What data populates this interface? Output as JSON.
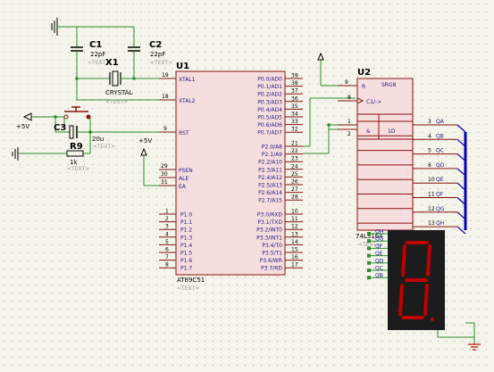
{
  "colors": {
    "background": "#f4f4ea",
    "grid_dot": "#a8a8a8",
    "wire": "#2e8b2e",
    "ic_body": "#f7dede",
    "ic_outline": "#8b1010",
    "bus": "#0000b8",
    "segment_off": "#c00000",
    "display_body": "#1c1c1c",
    "pin_label": "#1a1a8a",
    "text_placeholder": "#9a9a9a"
  },
  "u1": {
    "name": "U1",
    "part": "AT89C51",
    "text": "<TEXT>",
    "xtal1": "XTAL1",
    "xtal2": "XTAL2",
    "rst": "RST",
    "psen": "PSEN",
    "ale": "ALE",
    "ea": "EA",
    "pin_xtal1": "19",
    "pin_xtal2": "18",
    "pin_rst": "9",
    "pin_psen": "29",
    "pin_ale": "30",
    "pin_ea": "31",
    "p0": [
      {
        "name": "P0.0/AD0",
        "pin": "39"
      },
      {
        "name": "P0.1/AD1",
        "pin": "38"
      },
      {
        "name": "P0.2/AD2",
        "pin": "37"
      },
      {
        "name": "P0.3/AD3",
        "pin": "36"
      },
      {
        "name": "P0.4/AD4",
        "pin": "35"
      },
      {
        "name": "P0.5/AD5",
        "pin": "34"
      },
      {
        "name": "P0.6/AD6",
        "pin": "33"
      },
      {
        "name": "P0.7/AD7",
        "pin": "32"
      }
    ],
    "p2": [
      {
        "name": "P2.0/A8",
        "pin": "21"
      },
      {
        "name": "P2.1/A9",
        "pin": "22"
      },
      {
        "name": "P2.2/A10",
        "pin": "23"
      },
      {
        "name": "P2.3/A11",
        "pin": "24"
      },
      {
        "name": "P2.4/A12",
        "pin": "25"
      },
      {
        "name": "P2.5/A13",
        "pin": "26"
      },
      {
        "name": "P2.6/A14",
        "pin": "27"
      },
      {
        "name": "P2.7/A15",
        "pin": "28"
      }
    ],
    "p1": [
      {
        "name": "P1.0",
        "pin": "1"
      },
      {
        "name": "P1.1",
        "pin": "2"
      },
      {
        "name": "P1.2",
        "pin": "3"
      },
      {
        "name": "P1.3",
        "pin": "4"
      },
      {
        "name": "P1.4",
        "pin": "5"
      },
      {
        "name": "P1.5",
        "pin": "6"
      },
      {
        "name": "P1.6",
        "pin": "7"
      },
      {
        "name": "P1.7",
        "pin": "8"
      }
    ],
    "p3": [
      {
        "name": "P3.0/RXD",
        "pin": "10"
      },
      {
        "name": "P3.1/TXD",
        "pin": "11"
      },
      {
        "name": "P3.2/INT0",
        "pin": "12"
      },
      {
        "name": "P3.3/INT1",
        "pin": "13"
      },
      {
        "name": "P3.4/T0",
        "pin": "14"
      },
      {
        "name": "P3.5/T1",
        "pin": "15"
      },
      {
        "name": "P3.6/WR",
        "pin": "16"
      },
      {
        "name": "P3.7/RD",
        "pin": "17"
      }
    ]
  },
  "u2": {
    "name": "U2",
    "part": "74LS164",
    "text": "<TEXT>",
    "srg": "SRG8",
    "r": "R",
    "c1": "C1/->",
    "amp": "&",
    "d1": "1D",
    "pin_r": "9",
    "pin_c1": "8",
    "pin_a": "1",
    "pin_b": "2",
    "outputs": [
      {
        "name": "QA",
        "pin": "3"
      },
      {
        "name": "QB",
        "pin": "4"
      },
      {
        "name": "QC",
        "pin": "5"
      },
      {
        "name": "QD",
        "pin": "6"
      },
      {
        "name": "QE",
        "pin": "10"
      },
      {
        "name": "QF",
        "pin": "11"
      },
      {
        "name": "QG",
        "pin": "12"
      },
      {
        "name": "QH",
        "pin": "13"
      }
    ]
  },
  "c1": {
    "name": "C1",
    "value": "22pF",
    "text": "<TEXT>"
  },
  "c2": {
    "name": "C2",
    "value": "22pF",
    "text": "<TEXT>"
  },
  "c3": {
    "name": "C3",
    "value": "20u",
    "text": "<TEXT>"
  },
  "x1": {
    "name": "X1",
    "part": "CRYSTAL",
    "text": "<TEXT>"
  },
  "r9": {
    "name": "R9",
    "value": "1k",
    "text": "<TEXT>"
  },
  "power": {
    "vcc1": "+5V",
    "vcc2": "+5V"
  },
  "display": {
    "pins": [
      "QH",
      "QG",
      "QF",
      "QE",
      "QD",
      "QC",
      "QB"
    ]
  }
}
